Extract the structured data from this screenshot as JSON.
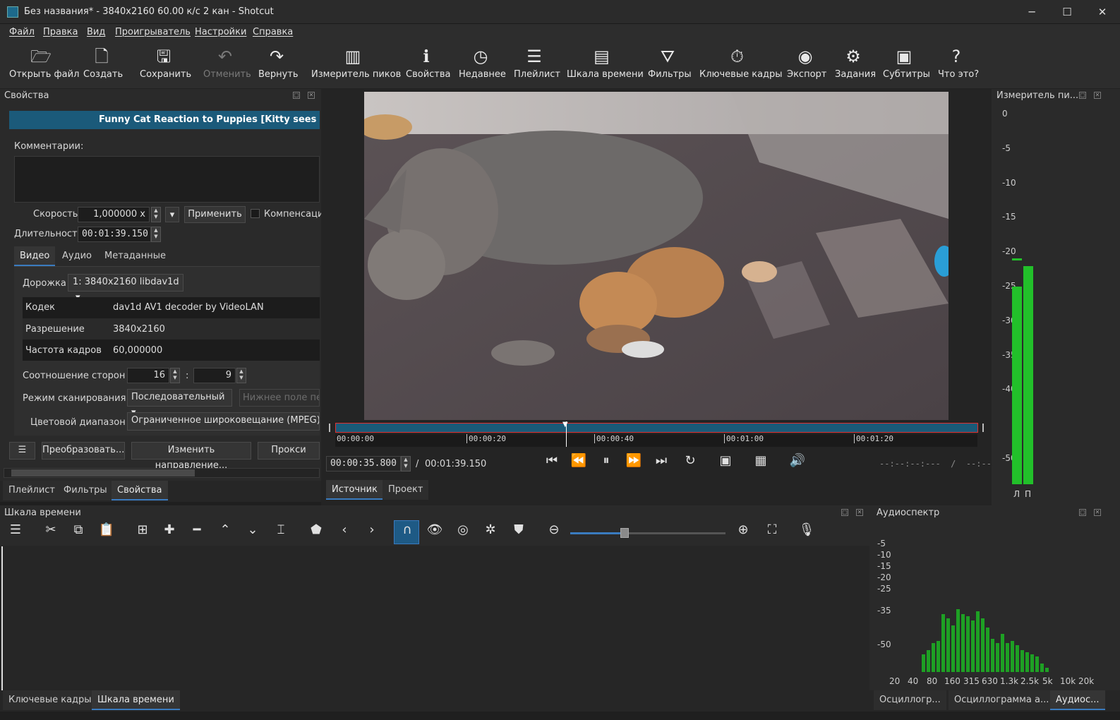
{
  "window": {
    "title": "Без названия* - 3840x2160 60.00 к/с 2 кан - Shotcut",
    "minimize": "─",
    "maximize": "☐",
    "close": "✕"
  },
  "menu": [
    "Файл",
    "Правка",
    "Вид",
    "Проигрыватель",
    "Настройки",
    "Справка"
  ],
  "toolbar": [
    {
      "icon": "folder-open-icon",
      "glyph": "🗁",
      "label": "Открыть файл",
      "enabled": true
    },
    {
      "icon": "new-file-icon",
      "glyph": "🗋",
      "label": "Создать",
      "enabled": true
    },
    {
      "icon": "save-icon",
      "glyph": "🖫",
      "label": "Сохранить",
      "enabled": true
    },
    {
      "icon": "undo-icon",
      "glyph": "↶",
      "label": "Отменить",
      "enabled": false
    },
    {
      "icon": "redo-icon",
      "glyph": "↷",
      "label": "Вернуть",
      "enabled": true
    },
    {
      "icon": "peak-meter-icon",
      "glyph": "▥",
      "label": "Измеритель пиков",
      "enabled": true
    },
    {
      "icon": "info-icon",
      "glyph": "ℹ",
      "label": "Свойства",
      "enabled": true
    },
    {
      "icon": "clock-icon",
      "glyph": "◷",
      "label": "Недавнее",
      "enabled": true
    },
    {
      "icon": "playlist-icon",
      "glyph": "☰",
      "label": "Плейлист",
      "enabled": true
    },
    {
      "icon": "timeline-icon",
      "glyph": "▤",
      "label": "Шкала времени",
      "enabled": true
    },
    {
      "icon": "filter-icon",
      "glyph": "⛛",
      "label": "Фильтры",
      "enabled": true
    },
    {
      "icon": "stopwatch-icon",
      "glyph": "⏱",
      "label": "Ключевые кадры",
      "enabled": true
    },
    {
      "icon": "export-icon",
      "glyph": "◉",
      "label": "Экспорт",
      "enabled": true
    },
    {
      "icon": "gear-icon",
      "glyph": "⚙",
      "label": "Задания",
      "enabled": true
    },
    {
      "icon": "subtitles-icon",
      "glyph": "▣",
      "label": "Субтитры",
      "enabled": true
    },
    {
      "icon": "help-icon",
      "glyph": "?",
      "label": "Что это?",
      "enabled": true
    }
  ],
  "properties": {
    "panel_title": "Свойства",
    "clip_name": "Funny Cat Reaction to Puppies [Kitty sees them fo",
    "comments_label": "Комментарии:",
    "speed_label": "Скорость",
    "speed_value": "1,000000 x",
    "apply_button": "Применить",
    "compensate_label": "Компенсаци",
    "duration_label": "Длительность",
    "duration_value": "00:01:39.150",
    "tabs": [
      "Видео",
      "Аудио",
      "Метаданные"
    ],
    "track_label": "Дорожка",
    "track_value": "1: 3840x2160 libdav1d",
    "rows": [
      {
        "key": "Кодек",
        "value": "dav1d AV1 decoder by VideoLAN"
      },
      {
        "key": "Разрешение",
        "value": "3840x2160"
      },
      {
        "key": "Частота кадров",
        "value": "60,000000"
      }
    ],
    "aspect_label": "Соотношение сторон",
    "aspect_w": "16",
    "aspect_sep": ":",
    "aspect_h": "9",
    "scan_label": "Режим сканирования",
    "scan_value": "Последовательный",
    "field_order_placeholder": "Нижнее поле пер",
    "color_range_label": "Цветовой диапазон",
    "color_range_value": "Ограниченное широковещание (MPEG)",
    "menu_button": "☰",
    "convert_button": "Преобразовать...",
    "reverse_button": "Изменить направление...",
    "proxy_button": "Прокси"
  },
  "left_tabs": [
    "Плейлист",
    "Фильтры",
    "Свойства"
  ],
  "player": {
    "ruler": [
      "00:00:00",
      "00:00:20",
      "00:00:40",
      "00:01:00",
      "00:01:20"
    ],
    "position": "00:00:35.800",
    "separator": "/",
    "duration": "00:01:39.150",
    "in_out": "--:--:--:---  /  --:--:--:---",
    "tabs": [
      "Источник",
      "Проект"
    ],
    "controls": [
      {
        "icon": "skip-start-icon",
        "glyph": "⏮"
      },
      {
        "icon": "rewind-icon",
        "glyph": "⏪"
      },
      {
        "icon": "pause-icon",
        "glyph": "⏸"
      },
      {
        "icon": "fast-forward-icon",
        "glyph": "⏩"
      },
      {
        "icon": "skip-end-icon",
        "glyph": "⏭"
      },
      {
        "icon": "loop-icon",
        "glyph": "↻"
      },
      {
        "icon": "zoom-fit-icon",
        "glyph": "▣"
      },
      {
        "icon": "grid-icon",
        "glyph": "▦"
      },
      {
        "icon": "volume-icon",
        "glyph": "🔊"
      }
    ]
  },
  "peak_meter": {
    "title": "Измеритель пи...",
    "ticks": [
      "0",
      "-5",
      "-10",
      "-15",
      "-20",
      "-25",
      "-30",
      "-35",
      "-40",
      "-50"
    ],
    "levels_db": [
      -25,
      -22
    ],
    "peak_db": -21,
    "channels": [
      "Л",
      "П"
    ],
    "color": "#22c02a"
  },
  "timeline": {
    "title": "Шкала времени",
    "tools": [
      {
        "icon": "menu-icon",
        "glyph": "☰"
      },
      {
        "icon": "cut-icon",
        "glyph": "✂"
      },
      {
        "icon": "copy-icon",
        "glyph": "⧉"
      },
      {
        "icon": "paste-icon",
        "glyph": "📋"
      },
      {
        "icon": "append-icon",
        "glyph": "⊞"
      },
      {
        "icon": "plus-icon",
        "glyph": "✚"
      },
      {
        "icon": "minus-icon",
        "glyph": "━"
      },
      {
        "icon": "lift-icon",
        "glyph": "⌃"
      },
      {
        "icon": "overwrite-icon",
        "glyph": "⌄"
      },
      {
        "icon": "split-icon",
        "glyph": "⌶"
      },
      {
        "icon": "marker-icon",
        "glyph": "⬟"
      },
      {
        "icon": "prev-icon",
        "glyph": "‹"
      },
      {
        "icon": "next-icon",
        "glyph": "›"
      },
      {
        "icon": "snap-magnet-icon",
        "glyph": "∩"
      },
      {
        "icon": "scrub-eye-icon",
        "glyph": "👁"
      },
      {
        "icon": "ripple-icon",
        "glyph": "◎"
      },
      {
        "icon": "ripple-all-icon",
        "glyph": "✲"
      },
      {
        "icon": "ripple-markers-icon",
        "glyph": "⛊"
      },
      {
        "icon": "zoom-out-icon",
        "glyph": "⊖"
      },
      {
        "icon": "zoom-in-icon",
        "glyph": "⊕"
      },
      {
        "icon": "zoom-fit-timeline-icon",
        "glyph": "⛶"
      },
      {
        "icon": "record-audio-icon",
        "glyph": "🎙"
      }
    ],
    "zoom_level": 0.35
  },
  "bottom_left_tabs": [
    "Ключевые кадры",
    "Шкала времени"
  ],
  "spectrum": {
    "title": "Аудиоспектр",
    "ticks": [
      "-5",
      "-10",
      "-15",
      "-20",
      "-25",
      "-35",
      "-50"
    ],
    "freqs": [
      "20",
      "40",
      "80",
      "160",
      "315",
      "630",
      "1.3k",
      "2.5k",
      "5k",
      "10k",
      "20k"
    ],
    "bars_db": [
      -54,
      -52,
      -49,
      -48,
      -36,
      -38,
      -41,
      -34,
      -36,
      -37,
      -39,
      -35,
      -38,
      -42,
      -47,
      -49,
      -45,
      -49,
      -48,
      -50,
      -52,
      -53,
      -54,
      -55,
      -58,
      -60
    ],
    "color": "#1ea024"
  },
  "bottom_right_tabs": [
    "Осциллогр...",
    "Осциллограмма а...",
    "Аудиос..."
  ],
  "colors": {
    "accent": "#3a7bbf",
    "clip_header": "#1b5a7a",
    "scrub": "#1a5a78",
    "in_marker": "#e03030"
  }
}
